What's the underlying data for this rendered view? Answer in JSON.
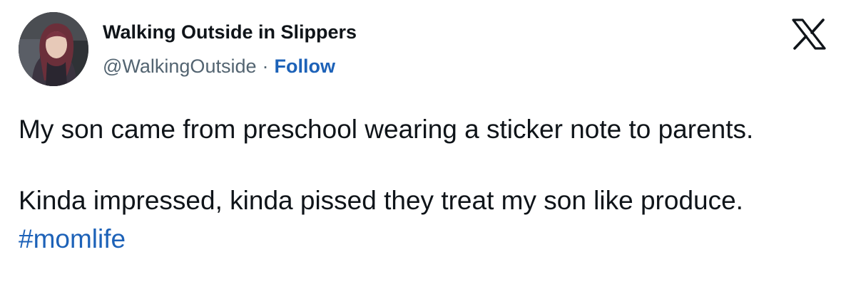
{
  "author": {
    "display_name": "Walking Outside in Slippers",
    "handle": "@WalkingOutside",
    "separator": "·",
    "follow_label": "Follow",
    "avatar": "profile-photo"
  },
  "brand": {
    "icon": "x-logo-icon"
  },
  "tweet": {
    "paragraph1": "My son came from preschool wearing a sticker note to parents.",
    "paragraph2_text": "Kinda impressed, kinda pissed they treat my son like produce. ",
    "hashtag": "#momlife"
  },
  "colors": {
    "text": "#0f1419",
    "secondary": "#536471",
    "link": "#1d62b8"
  }
}
